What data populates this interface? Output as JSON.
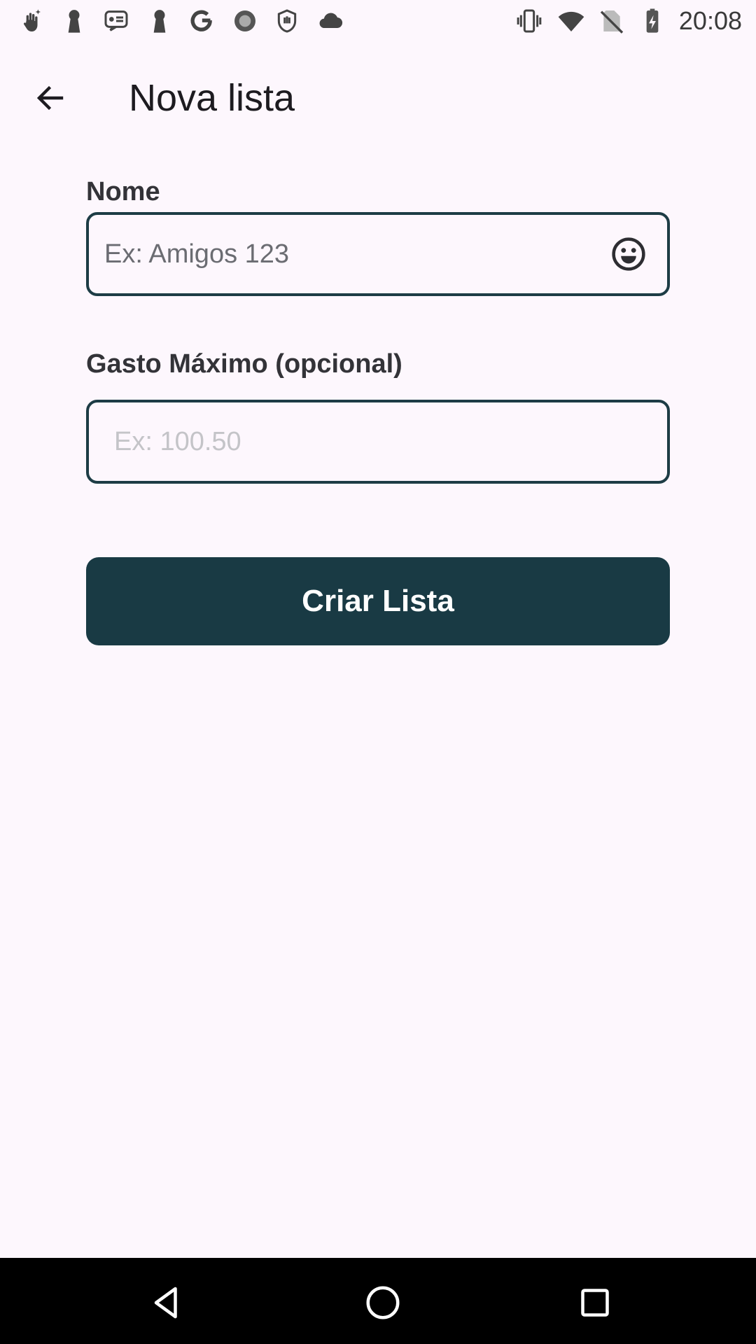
{
  "status_bar": {
    "time": "20:08",
    "left_icons": [
      "hand-sparkle-icon",
      "keyhole-icon",
      "message-card-icon",
      "keyhole-icon",
      "google-icon",
      "circle-record-icon",
      "hand-shield-icon",
      "cloud-icon"
    ],
    "right_icons": [
      "vibrate-icon",
      "wifi-icon",
      "no-sim-icon",
      "battery-charging-icon"
    ]
  },
  "app_bar": {
    "title": "Nova lista",
    "back_icon": "arrow-left-icon"
  },
  "form": {
    "nome": {
      "label": "Nome",
      "value": "",
      "placeholder": "Ex: Amigos 123",
      "trailing_icon": "emoji-smile-icon"
    },
    "gasto": {
      "label": "Gasto Máximo (opcional)",
      "value": "",
      "placeholder": "Ex: 100.50"
    },
    "submit_label": "Criar Lista"
  },
  "nav_bar": {
    "icons": [
      "nav-back-triangle-icon",
      "nav-home-circle-icon",
      "nav-recents-square-icon"
    ]
  },
  "colors": {
    "background": "#fdf7fd",
    "primary": "#193a44",
    "field_border": "#1d3c45",
    "nav_bar": "#000000"
  }
}
